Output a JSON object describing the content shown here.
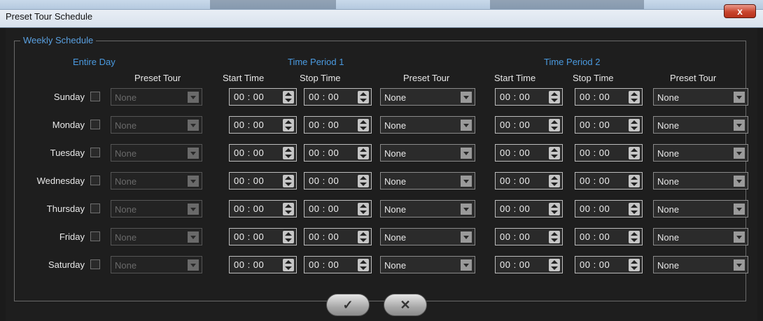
{
  "window": {
    "title": "Preset Tour Schedule",
    "close_label": "x"
  },
  "schedule": {
    "legend": "Weekly Schedule",
    "entire_day_header": "Entire Day",
    "period1_header": "Time Period 1",
    "period2_header": "Time Period 2",
    "col_preset_tour": "Preset Tour",
    "col_start_time": "Start Time",
    "col_stop_time": "Stop Time",
    "rows": [
      {
        "day": "Sunday",
        "entire_preset": "None",
        "p1_start": "00 : 00",
        "p1_stop": "00 : 00",
        "p1_preset": "None",
        "p2_start": "00 : 00",
        "p2_stop": "00 : 00",
        "p2_preset": "None"
      },
      {
        "day": "Monday",
        "entire_preset": "None",
        "p1_start": "00 : 00",
        "p1_stop": "00 : 00",
        "p1_preset": "None",
        "p2_start": "00 : 00",
        "p2_stop": "00 : 00",
        "p2_preset": "None"
      },
      {
        "day": "Tuesday",
        "entire_preset": "None",
        "p1_start": "00 : 00",
        "p1_stop": "00 : 00",
        "p1_preset": "None",
        "p2_start": "00 : 00",
        "p2_stop": "00 : 00",
        "p2_preset": "None"
      },
      {
        "day": "Wednesday",
        "entire_preset": "None",
        "p1_start": "00 : 00",
        "p1_stop": "00 : 00",
        "p1_preset": "None",
        "p2_start": "00 : 00",
        "p2_stop": "00 : 00",
        "p2_preset": "None"
      },
      {
        "day": "Thursday",
        "entire_preset": "None",
        "p1_start": "00 : 00",
        "p1_stop": "00 : 00",
        "p1_preset": "None",
        "p2_start": "00 : 00",
        "p2_stop": "00 : 00",
        "p2_preset": "None"
      },
      {
        "day": "Friday",
        "entire_preset": "None",
        "p1_start": "00 : 00",
        "p1_stop": "00 : 00",
        "p1_preset": "None",
        "p2_start": "00 : 00",
        "p2_stop": "00 : 00",
        "p2_preset": "None"
      },
      {
        "day": "Saturday",
        "entire_preset": "None",
        "p1_start": "00 : 00",
        "p1_stop": "00 : 00",
        "p1_preset": "None",
        "p2_start": "00 : 00",
        "p2_stop": "00 : 00",
        "p2_preset": "None"
      }
    ]
  },
  "footer": {
    "ok_label": "✓",
    "cancel_label": "✕"
  },
  "colors": {
    "accent": "#4a9ae0",
    "background": "#1e1e1e",
    "close": "#c9452e"
  }
}
